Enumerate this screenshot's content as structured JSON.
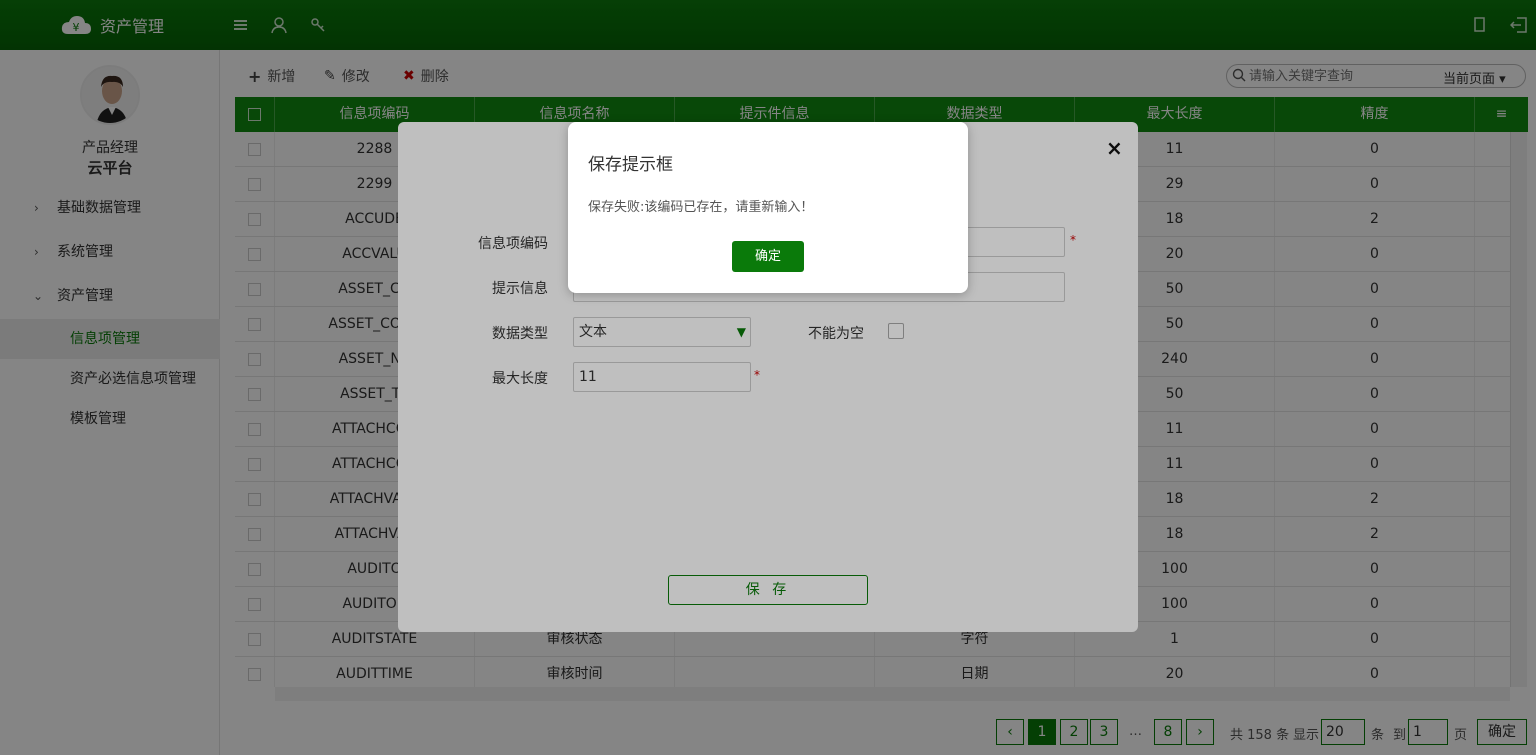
{
  "app": {
    "title": "资产管理"
  },
  "user": {
    "role": "产品经理",
    "name": "云平台"
  },
  "sidebar": {
    "menus": [
      {
        "label": "基础数据管理",
        "expanded": false
      },
      {
        "label": "系统管理",
        "expanded": false
      },
      {
        "label": "资产管理",
        "expanded": true
      }
    ],
    "submenus": [
      {
        "label": "信息项管理",
        "active": true
      },
      {
        "label": "资产必选信息项管理",
        "active": false
      },
      {
        "label": "模板管理",
        "active": false
      }
    ]
  },
  "toolbar": {
    "add": "新增",
    "edit": "修改",
    "delete": "删除"
  },
  "search": {
    "placeholder": "请输入关键字查询",
    "scope": "当前页面"
  },
  "table": {
    "columns": [
      "信息项编码",
      "信息项名称",
      "提示件信息",
      "数据类型",
      "最大长度",
      "精度"
    ],
    "rows": [
      [
        "2288",
        "",
        "",
        "",
        "11",
        "0"
      ],
      [
        "2299",
        "",
        "",
        "",
        "29",
        "0"
      ],
      [
        "ACCUDE",
        "",
        "",
        "",
        "18",
        "2"
      ],
      [
        "ACCVALU",
        "",
        "",
        "",
        "20",
        "0"
      ],
      [
        "ASSET_CO",
        "",
        "",
        "",
        "50",
        "0"
      ],
      [
        "ASSET_CODE",
        "",
        "",
        "",
        "50",
        "0"
      ],
      [
        "ASSET_NA",
        "",
        "",
        "",
        "240",
        "0"
      ],
      [
        "ASSET_TY",
        "",
        "",
        "",
        "50",
        "0"
      ],
      [
        "ATTACHCOU",
        "",
        "",
        "",
        "11",
        "0"
      ],
      [
        "ATTACHCOU",
        "",
        "",
        "",
        "11",
        "0"
      ],
      [
        "ATTACHVALU",
        "",
        "",
        "",
        "18",
        "2"
      ],
      [
        "ATTACHVAL",
        "",
        "",
        "",
        "18",
        "2"
      ],
      [
        "AUDITO",
        "",
        "",
        "",
        "100",
        "0"
      ],
      [
        "AUDITOR",
        "",
        "",
        "",
        "100",
        "0"
      ],
      [
        "AUDITSTATE",
        "审核状态",
        "",
        "字符",
        "1",
        "0"
      ],
      [
        "AUDITTIME",
        "审核时间",
        "",
        "日期",
        "20",
        "0"
      ]
    ]
  },
  "pagination": {
    "pages": [
      "1",
      "2",
      "3",
      "8"
    ],
    "ellipsis": "…",
    "total_prefix": "共 158 条",
    "show_label": "显示",
    "page_size": "20",
    "per_unit": "条",
    "goto_label": "到",
    "goto_page": "1",
    "page_unit": "页",
    "confirm": "确定"
  },
  "form_dialog": {
    "fields": {
      "code_label": "信息项编码",
      "hint_label": "提示信息",
      "type_label": "数据类型",
      "type_value": "文本",
      "notnull_label": "不能为空",
      "maxlen_label": "最大长度",
      "maxlen_value": "11"
    },
    "required_mark": "*",
    "save": "保 存",
    "close": "×"
  },
  "alert": {
    "title": "保存提示框",
    "message": "保存失败:该编码已存在，请重新输入！",
    "ok": "确定"
  },
  "colors": {
    "primary": "#0a7a0a",
    "header": "#118a11",
    "required": "#cc0000"
  }
}
